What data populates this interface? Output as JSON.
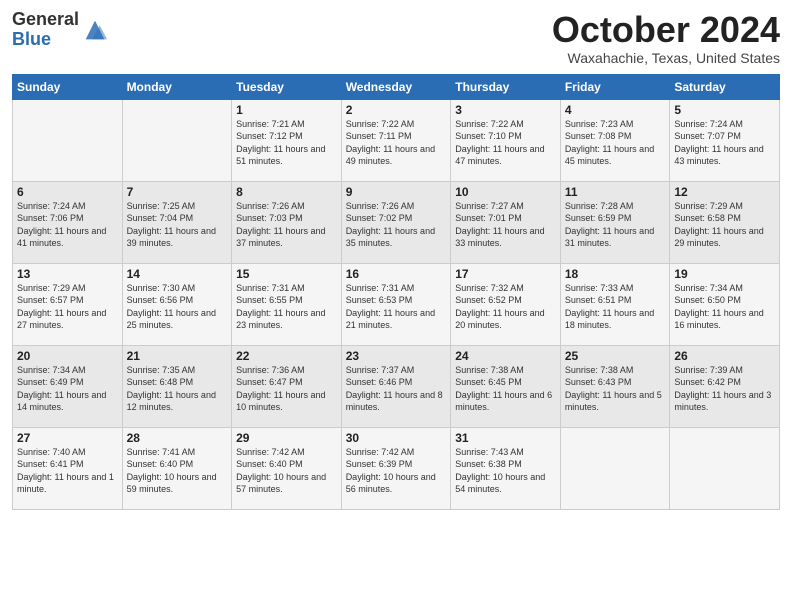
{
  "header": {
    "logo_line1": "General",
    "logo_line2": "Blue",
    "month": "October 2024",
    "location": "Waxahachie, Texas, United States"
  },
  "days_of_week": [
    "Sunday",
    "Monday",
    "Tuesday",
    "Wednesday",
    "Thursday",
    "Friday",
    "Saturday"
  ],
  "weeks": [
    [
      {
        "day": "",
        "info": ""
      },
      {
        "day": "",
        "info": ""
      },
      {
        "day": "1",
        "info": "Sunrise: 7:21 AM\nSunset: 7:12 PM\nDaylight: 11 hours and 51 minutes."
      },
      {
        "day": "2",
        "info": "Sunrise: 7:22 AM\nSunset: 7:11 PM\nDaylight: 11 hours and 49 minutes."
      },
      {
        "day": "3",
        "info": "Sunrise: 7:22 AM\nSunset: 7:10 PM\nDaylight: 11 hours and 47 minutes."
      },
      {
        "day": "4",
        "info": "Sunrise: 7:23 AM\nSunset: 7:08 PM\nDaylight: 11 hours and 45 minutes."
      },
      {
        "day": "5",
        "info": "Sunrise: 7:24 AM\nSunset: 7:07 PM\nDaylight: 11 hours and 43 minutes."
      }
    ],
    [
      {
        "day": "6",
        "info": "Sunrise: 7:24 AM\nSunset: 7:06 PM\nDaylight: 11 hours and 41 minutes."
      },
      {
        "day": "7",
        "info": "Sunrise: 7:25 AM\nSunset: 7:04 PM\nDaylight: 11 hours and 39 minutes."
      },
      {
        "day": "8",
        "info": "Sunrise: 7:26 AM\nSunset: 7:03 PM\nDaylight: 11 hours and 37 minutes."
      },
      {
        "day": "9",
        "info": "Sunrise: 7:26 AM\nSunset: 7:02 PM\nDaylight: 11 hours and 35 minutes."
      },
      {
        "day": "10",
        "info": "Sunrise: 7:27 AM\nSunset: 7:01 PM\nDaylight: 11 hours and 33 minutes."
      },
      {
        "day": "11",
        "info": "Sunrise: 7:28 AM\nSunset: 6:59 PM\nDaylight: 11 hours and 31 minutes."
      },
      {
        "day": "12",
        "info": "Sunrise: 7:29 AM\nSunset: 6:58 PM\nDaylight: 11 hours and 29 minutes."
      }
    ],
    [
      {
        "day": "13",
        "info": "Sunrise: 7:29 AM\nSunset: 6:57 PM\nDaylight: 11 hours and 27 minutes."
      },
      {
        "day": "14",
        "info": "Sunrise: 7:30 AM\nSunset: 6:56 PM\nDaylight: 11 hours and 25 minutes."
      },
      {
        "day": "15",
        "info": "Sunrise: 7:31 AM\nSunset: 6:55 PM\nDaylight: 11 hours and 23 minutes."
      },
      {
        "day": "16",
        "info": "Sunrise: 7:31 AM\nSunset: 6:53 PM\nDaylight: 11 hours and 21 minutes."
      },
      {
        "day": "17",
        "info": "Sunrise: 7:32 AM\nSunset: 6:52 PM\nDaylight: 11 hours and 20 minutes."
      },
      {
        "day": "18",
        "info": "Sunrise: 7:33 AM\nSunset: 6:51 PM\nDaylight: 11 hours and 18 minutes."
      },
      {
        "day": "19",
        "info": "Sunrise: 7:34 AM\nSunset: 6:50 PM\nDaylight: 11 hours and 16 minutes."
      }
    ],
    [
      {
        "day": "20",
        "info": "Sunrise: 7:34 AM\nSunset: 6:49 PM\nDaylight: 11 hours and 14 minutes."
      },
      {
        "day": "21",
        "info": "Sunrise: 7:35 AM\nSunset: 6:48 PM\nDaylight: 11 hours and 12 minutes."
      },
      {
        "day": "22",
        "info": "Sunrise: 7:36 AM\nSunset: 6:47 PM\nDaylight: 11 hours and 10 minutes."
      },
      {
        "day": "23",
        "info": "Sunrise: 7:37 AM\nSunset: 6:46 PM\nDaylight: 11 hours and 8 minutes."
      },
      {
        "day": "24",
        "info": "Sunrise: 7:38 AM\nSunset: 6:45 PM\nDaylight: 11 hours and 6 minutes."
      },
      {
        "day": "25",
        "info": "Sunrise: 7:38 AM\nSunset: 6:43 PM\nDaylight: 11 hours and 5 minutes."
      },
      {
        "day": "26",
        "info": "Sunrise: 7:39 AM\nSunset: 6:42 PM\nDaylight: 11 hours and 3 minutes."
      }
    ],
    [
      {
        "day": "27",
        "info": "Sunrise: 7:40 AM\nSunset: 6:41 PM\nDaylight: 11 hours and 1 minute."
      },
      {
        "day": "28",
        "info": "Sunrise: 7:41 AM\nSunset: 6:40 PM\nDaylight: 10 hours and 59 minutes."
      },
      {
        "day": "29",
        "info": "Sunrise: 7:42 AM\nSunset: 6:40 PM\nDaylight: 10 hours and 57 minutes."
      },
      {
        "day": "30",
        "info": "Sunrise: 7:42 AM\nSunset: 6:39 PM\nDaylight: 10 hours and 56 minutes."
      },
      {
        "day": "31",
        "info": "Sunrise: 7:43 AM\nSunset: 6:38 PM\nDaylight: 10 hours and 54 minutes."
      },
      {
        "day": "",
        "info": ""
      },
      {
        "day": "",
        "info": ""
      }
    ]
  ]
}
